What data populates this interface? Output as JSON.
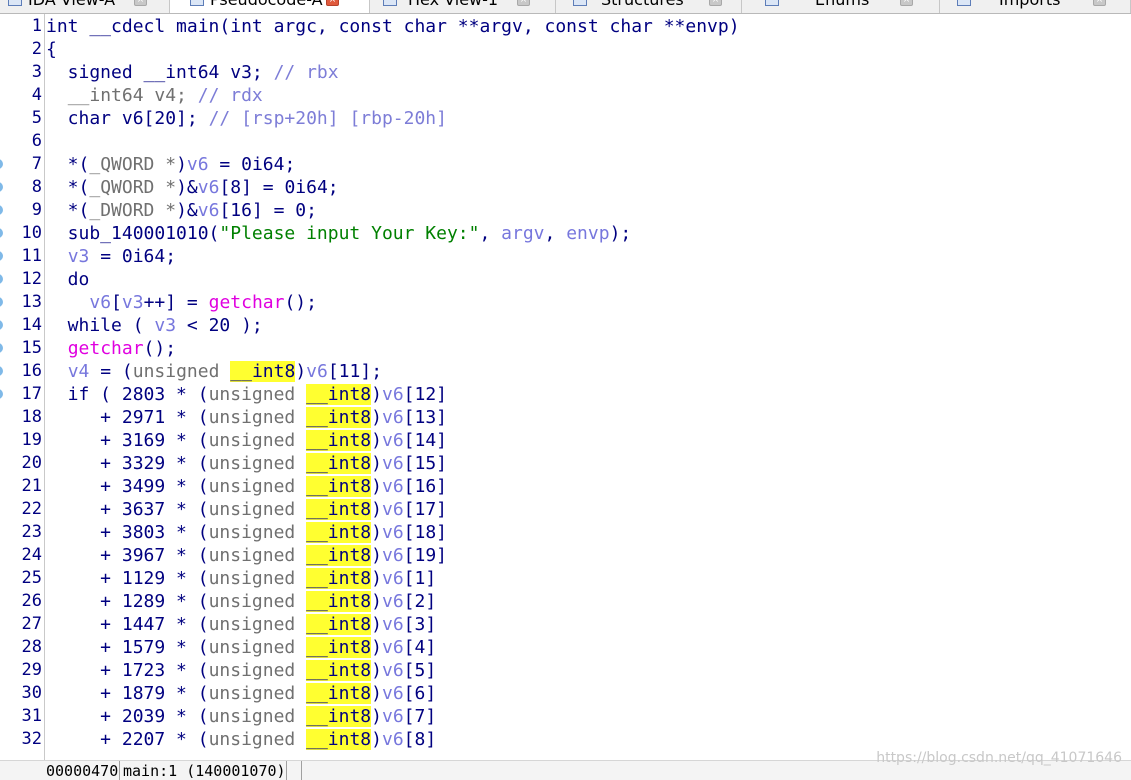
{
  "tabs": [
    {
      "label": "IDA View-A",
      "active": false,
      "close_style": "gray"
    },
    {
      "label": "Pseudocode-A",
      "active": true,
      "close_style": "red"
    },
    {
      "label": "Hex View-1",
      "active": false,
      "close_style": "gray"
    },
    {
      "label": "Structures",
      "active": false,
      "close_style": "gray"
    },
    {
      "label": "Enums",
      "active": false,
      "close_style": "gray"
    },
    {
      "label": "Imports",
      "active": false,
      "close_style": "gray"
    }
  ],
  "line_numbers": [
    "1",
    "2",
    "3",
    "4",
    "5",
    "6",
    "7",
    "8",
    "9",
    "10",
    "11",
    "12",
    "13",
    "14",
    "15",
    "16",
    "17",
    "18",
    "19",
    "20",
    "21",
    "22",
    "23",
    "24",
    "25",
    "26",
    "27",
    "28",
    "29",
    "30",
    "31",
    "32"
  ],
  "breakpoint_lines": [
    "7",
    "8",
    "9",
    "10",
    "11",
    "12",
    "13",
    "14",
    "15",
    "16",
    "17"
  ],
  "code_lines": [
    [
      [
        "int __cdecl main(int argc, const char **argv, const char **envp)",
        "kw"
      ]
    ],
    [
      [
        "{",
        "kw"
      ]
    ],
    [
      [
        "  signed __int64 v3; ",
        "kw"
      ],
      [
        "// rbx",
        "cm"
      ]
    ],
    [
      [
        "  ",
        "kw"
      ],
      [
        "__int64 v4; ",
        "ty"
      ],
      [
        "// rdx",
        "cm"
      ]
    ],
    [
      [
        "  char v6[20]; ",
        "kw"
      ],
      [
        "// [rsp+20h] [rbp-20h]",
        "cm"
      ]
    ],
    [
      [
        "",
        "kw"
      ]
    ],
    [
      [
        "  *(",
        "kw"
      ],
      [
        "_QWORD *",
        "ty"
      ],
      [
        ")",
        "kw"
      ],
      [
        "v6",
        "var"
      ],
      [
        " = 0i64;",
        "kw"
      ]
    ],
    [
      [
        "  *(",
        "kw"
      ],
      [
        "_QWORD *",
        "ty"
      ],
      [
        ")&",
        "kw"
      ],
      [
        "v6",
        "var"
      ],
      [
        "[8] = 0i64;",
        "kw"
      ]
    ],
    [
      [
        "  *(",
        "kw"
      ],
      [
        "_DWORD *",
        "ty"
      ],
      [
        ")&",
        "kw"
      ],
      [
        "v6",
        "var"
      ],
      [
        "[16] = 0;",
        "kw"
      ]
    ],
    [
      [
        "  sub_140001010(",
        "kw"
      ],
      [
        "\"Please input Your Key:\"",
        "str"
      ],
      [
        ", ",
        "kw"
      ],
      [
        "argv",
        "var"
      ],
      [
        ", ",
        "kw"
      ],
      [
        "envp",
        "var"
      ],
      [
        ");",
        "kw"
      ]
    ],
    [
      [
        "  ",
        "kw"
      ],
      [
        "v3",
        "var"
      ],
      [
        " = 0i64;",
        "kw"
      ]
    ],
    [
      [
        "  do",
        "kw"
      ]
    ],
    [
      [
        "    ",
        "kw"
      ],
      [
        "v6",
        "var"
      ],
      [
        "[",
        "kw"
      ],
      [
        "v3",
        "var"
      ],
      [
        "++] = ",
        "kw"
      ],
      [
        "getchar",
        "fn"
      ],
      [
        "();",
        "kw"
      ]
    ],
    [
      [
        "  while ( ",
        "kw"
      ],
      [
        "v3",
        "var"
      ],
      [
        " < 20 );",
        "kw"
      ]
    ],
    [
      [
        "  ",
        "kw"
      ],
      [
        "getchar",
        "fn"
      ],
      [
        "();",
        "kw"
      ]
    ],
    [
      [
        "  ",
        "kw"
      ],
      [
        "v4",
        "var"
      ],
      [
        " = (",
        "kw"
      ],
      [
        "unsigned ",
        "ty"
      ],
      [
        "__int8",
        "hl"
      ],
      [
        ")",
        "kw"
      ],
      [
        "v6",
        "var"
      ],
      [
        "[11];",
        "kw"
      ]
    ],
    [
      [
        "  if ( 2803 * (",
        "kw"
      ],
      [
        "unsigned ",
        "ty"
      ],
      [
        "__int8",
        "hl"
      ],
      [
        ")",
        "kw"
      ],
      [
        "v6",
        "var"
      ],
      [
        "[12]",
        "kw"
      ]
    ],
    [
      [
        "     + 2971 * (",
        "kw"
      ],
      [
        "unsigned ",
        "ty"
      ],
      [
        "__int8",
        "hl"
      ],
      [
        ")",
        "kw"
      ],
      [
        "v6",
        "var"
      ],
      [
        "[13]",
        "kw"
      ]
    ],
    [
      [
        "     + 3169 * (",
        "kw"
      ],
      [
        "unsigned ",
        "ty"
      ],
      [
        "__int8",
        "hl"
      ],
      [
        ")",
        "kw"
      ],
      [
        "v6",
        "var"
      ],
      [
        "[14]",
        "kw"
      ]
    ],
    [
      [
        "     + 3329 * (",
        "kw"
      ],
      [
        "unsigned ",
        "ty"
      ],
      [
        "__int8",
        "hl"
      ],
      [
        ")",
        "kw"
      ],
      [
        "v6",
        "var"
      ],
      [
        "[15]",
        "kw"
      ]
    ],
    [
      [
        "     + 3499 * (",
        "kw"
      ],
      [
        "unsigned ",
        "ty"
      ],
      [
        "__int8",
        "hl"
      ],
      [
        ")",
        "kw"
      ],
      [
        "v6",
        "var"
      ],
      [
        "[16]",
        "kw"
      ]
    ],
    [
      [
        "     + 3637 * (",
        "kw"
      ],
      [
        "unsigned ",
        "ty"
      ],
      [
        "__int8",
        "hl"
      ],
      [
        ")",
        "kw"
      ],
      [
        "v6",
        "var"
      ],
      [
        "[17]",
        "kw"
      ]
    ],
    [
      [
        "     + 3803 * (",
        "kw"
      ],
      [
        "unsigned ",
        "ty"
      ],
      [
        "__int8",
        "hl"
      ],
      [
        ")",
        "kw"
      ],
      [
        "v6",
        "var"
      ],
      [
        "[18]",
        "kw"
      ]
    ],
    [
      [
        "     + 3967 * (",
        "kw"
      ],
      [
        "unsigned ",
        "ty"
      ],
      [
        "__int8",
        "hl"
      ],
      [
        ")",
        "kw"
      ],
      [
        "v6",
        "var"
      ],
      [
        "[19]",
        "kw"
      ]
    ],
    [
      [
        "     + 1129 * (",
        "kw"
      ],
      [
        "unsigned ",
        "ty"
      ],
      [
        "__int8",
        "hl"
      ],
      [
        ")",
        "kw"
      ],
      [
        "v6",
        "var"
      ],
      [
        "[1]",
        "kw"
      ]
    ],
    [
      [
        "     + 1289 * (",
        "kw"
      ],
      [
        "unsigned ",
        "ty"
      ],
      [
        "__int8",
        "hl"
      ],
      [
        ")",
        "kw"
      ],
      [
        "v6",
        "var"
      ],
      [
        "[2]",
        "kw"
      ]
    ],
    [
      [
        "     + 1447 * (",
        "kw"
      ],
      [
        "unsigned ",
        "ty"
      ],
      [
        "__int8",
        "hl"
      ],
      [
        ")",
        "kw"
      ],
      [
        "v6",
        "var"
      ],
      [
        "[3]",
        "kw"
      ]
    ],
    [
      [
        "     + 1579 * (",
        "kw"
      ],
      [
        "unsigned ",
        "ty"
      ],
      [
        "__int8",
        "hl"
      ],
      [
        ")",
        "kw"
      ],
      [
        "v6",
        "var"
      ],
      [
        "[4]",
        "kw"
      ]
    ],
    [
      [
        "     + 1723 * (",
        "kw"
      ],
      [
        "unsigned ",
        "ty"
      ],
      [
        "__int8",
        "hl"
      ],
      [
        ")",
        "kw"
      ],
      [
        "v6",
        "var"
      ],
      [
        "[5]",
        "kw"
      ]
    ],
    [
      [
        "     + 1879 * (",
        "kw"
      ],
      [
        "unsigned ",
        "ty"
      ],
      [
        "__int8",
        "hl"
      ],
      [
        ")",
        "kw"
      ],
      [
        "v6",
        "var"
      ],
      [
        "[6]",
        "kw"
      ]
    ],
    [
      [
        "     + 2039 * (",
        "kw"
      ],
      [
        "unsigned ",
        "ty"
      ],
      [
        "__int8",
        "hl"
      ],
      [
        ")",
        "kw"
      ],
      [
        "v6",
        "var"
      ],
      [
        "[7]",
        "kw"
      ]
    ],
    [
      [
        "     + 2207 * (",
        "kw"
      ],
      [
        "unsigned ",
        "ty"
      ],
      [
        "__int8",
        "hl"
      ],
      [
        ")",
        "kw"
      ],
      [
        "v6",
        "var"
      ],
      [
        "[8]",
        "kw"
      ]
    ]
  ],
  "status": {
    "offset": "00000470",
    "location": "main:1 (140001070)"
  },
  "watermark": "https://blog.csdn.net/qq_41071646",
  "colors": {
    "keyword": "#000080",
    "variable": "#7777dd",
    "comment": "#7d7dd7",
    "string": "#008000",
    "function": "#e000e0",
    "type": "#707070",
    "highlight": "#ffff30"
  }
}
